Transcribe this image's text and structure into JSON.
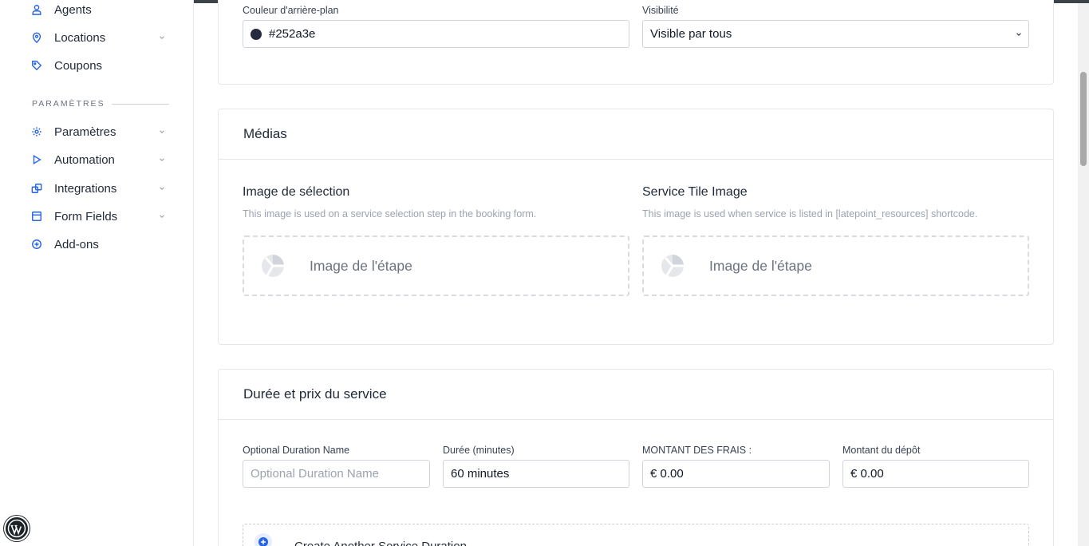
{
  "sidebar": {
    "items": [
      {
        "label": "Agents",
        "icon": "user-icon",
        "has_submenu": false
      },
      {
        "label": "Locations",
        "icon": "map-pin-icon",
        "has_submenu": true
      },
      {
        "label": "Coupons",
        "icon": "tag-icon",
        "has_submenu": false
      }
    ],
    "section_title": "PARAMÈTRES",
    "settings_items": [
      {
        "label": "Paramètres",
        "icon": "gear-icon",
        "has_submenu": true
      },
      {
        "label": "Automation",
        "icon": "play-icon",
        "has_submenu": true
      },
      {
        "label": "Integrations",
        "icon": "integrations-icon",
        "has_submenu": true
      },
      {
        "label": "Form Fields",
        "icon": "form-icon",
        "has_submenu": true
      },
      {
        "label": "Add-ons",
        "icon": "plus-circle-icon",
        "has_submenu": false
      }
    ]
  },
  "general": {
    "bg_color_label": "Couleur d'arrière-plan",
    "bg_color_value": "#252a3e",
    "visibility_label": "Visibilité",
    "visibility_value": "Visible par tous"
  },
  "media": {
    "title": "Médias",
    "selection_image": {
      "title": "Image de sélection",
      "description": "This image is used on a service selection step in the booking form.",
      "upload_label": "Image de l'étape"
    },
    "tile_image": {
      "title": "Service Tile Image",
      "description": "This image is used when service is listed in [latepoint_resources] shortcode.",
      "upload_label": "Image de l'étape"
    }
  },
  "duration": {
    "title": "Durée et prix du service",
    "optional_name_label": "Optional Duration Name",
    "optional_name_placeholder": "Optional Duration Name",
    "duration_label": "Durée (minutes)",
    "duration_value": "60 minutes",
    "charge_label": "MONTANT DES FRAIS :",
    "charge_value": "€ 0.00",
    "deposit_label": "Montant du dépôt",
    "deposit_value": "€ 0.00",
    "add_duration_label": "Create Another Service Duration"
  },
  "colors": {
    "accent": "#2563eb",
    "text": "#1f2937",
    "border": "#e5e7eb"
  }
}
